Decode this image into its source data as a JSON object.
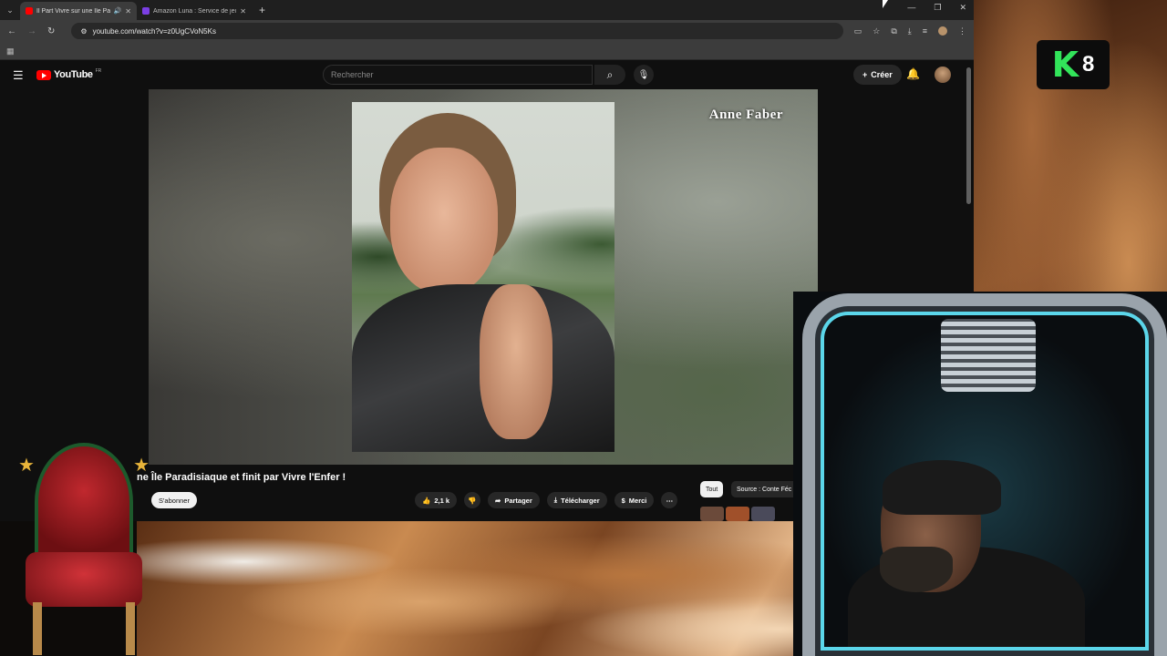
{
  "browser": {
    "tabs": [
      {
        "title": "Il Part Vivre sur une Île Parad...",
        "favicon_color": "#ff0000",
        "active": true
      },
      {
        "title": "Amazon Luna : Service de jeux",
        "favicon_color": "#7b3fe4",
        "active": false
      }
    ],
    "url": "youtube.com/watch?v=z0UgCVoN5Ks"
  },
  "youtube": {
    "logo_text": "YouTube",
    "country_code": "FR",
    "search_placeholder": "Rechercher",
    "create_label": "Créer",
    "video": {
      "watermark": "Anne Faber",
      "title": "ne Île Paradisiaque et finit par Vivre l'Enfer !",
      "subscribe_label": "S'abonner",
      "likes": "2,1 k",
      "share_label": "Partager",
      "download_label": "Télécharger",
      "thanks_label": "Merci"
    },
    "chips": {
      "all": "Tout",
      "source": "Source : Conte Féc"
    }
  },
  "overlay": {
    "k8_letter": "K",
    "k8_number": "8",
    "k8_color": "#32e45a"
  }
}
